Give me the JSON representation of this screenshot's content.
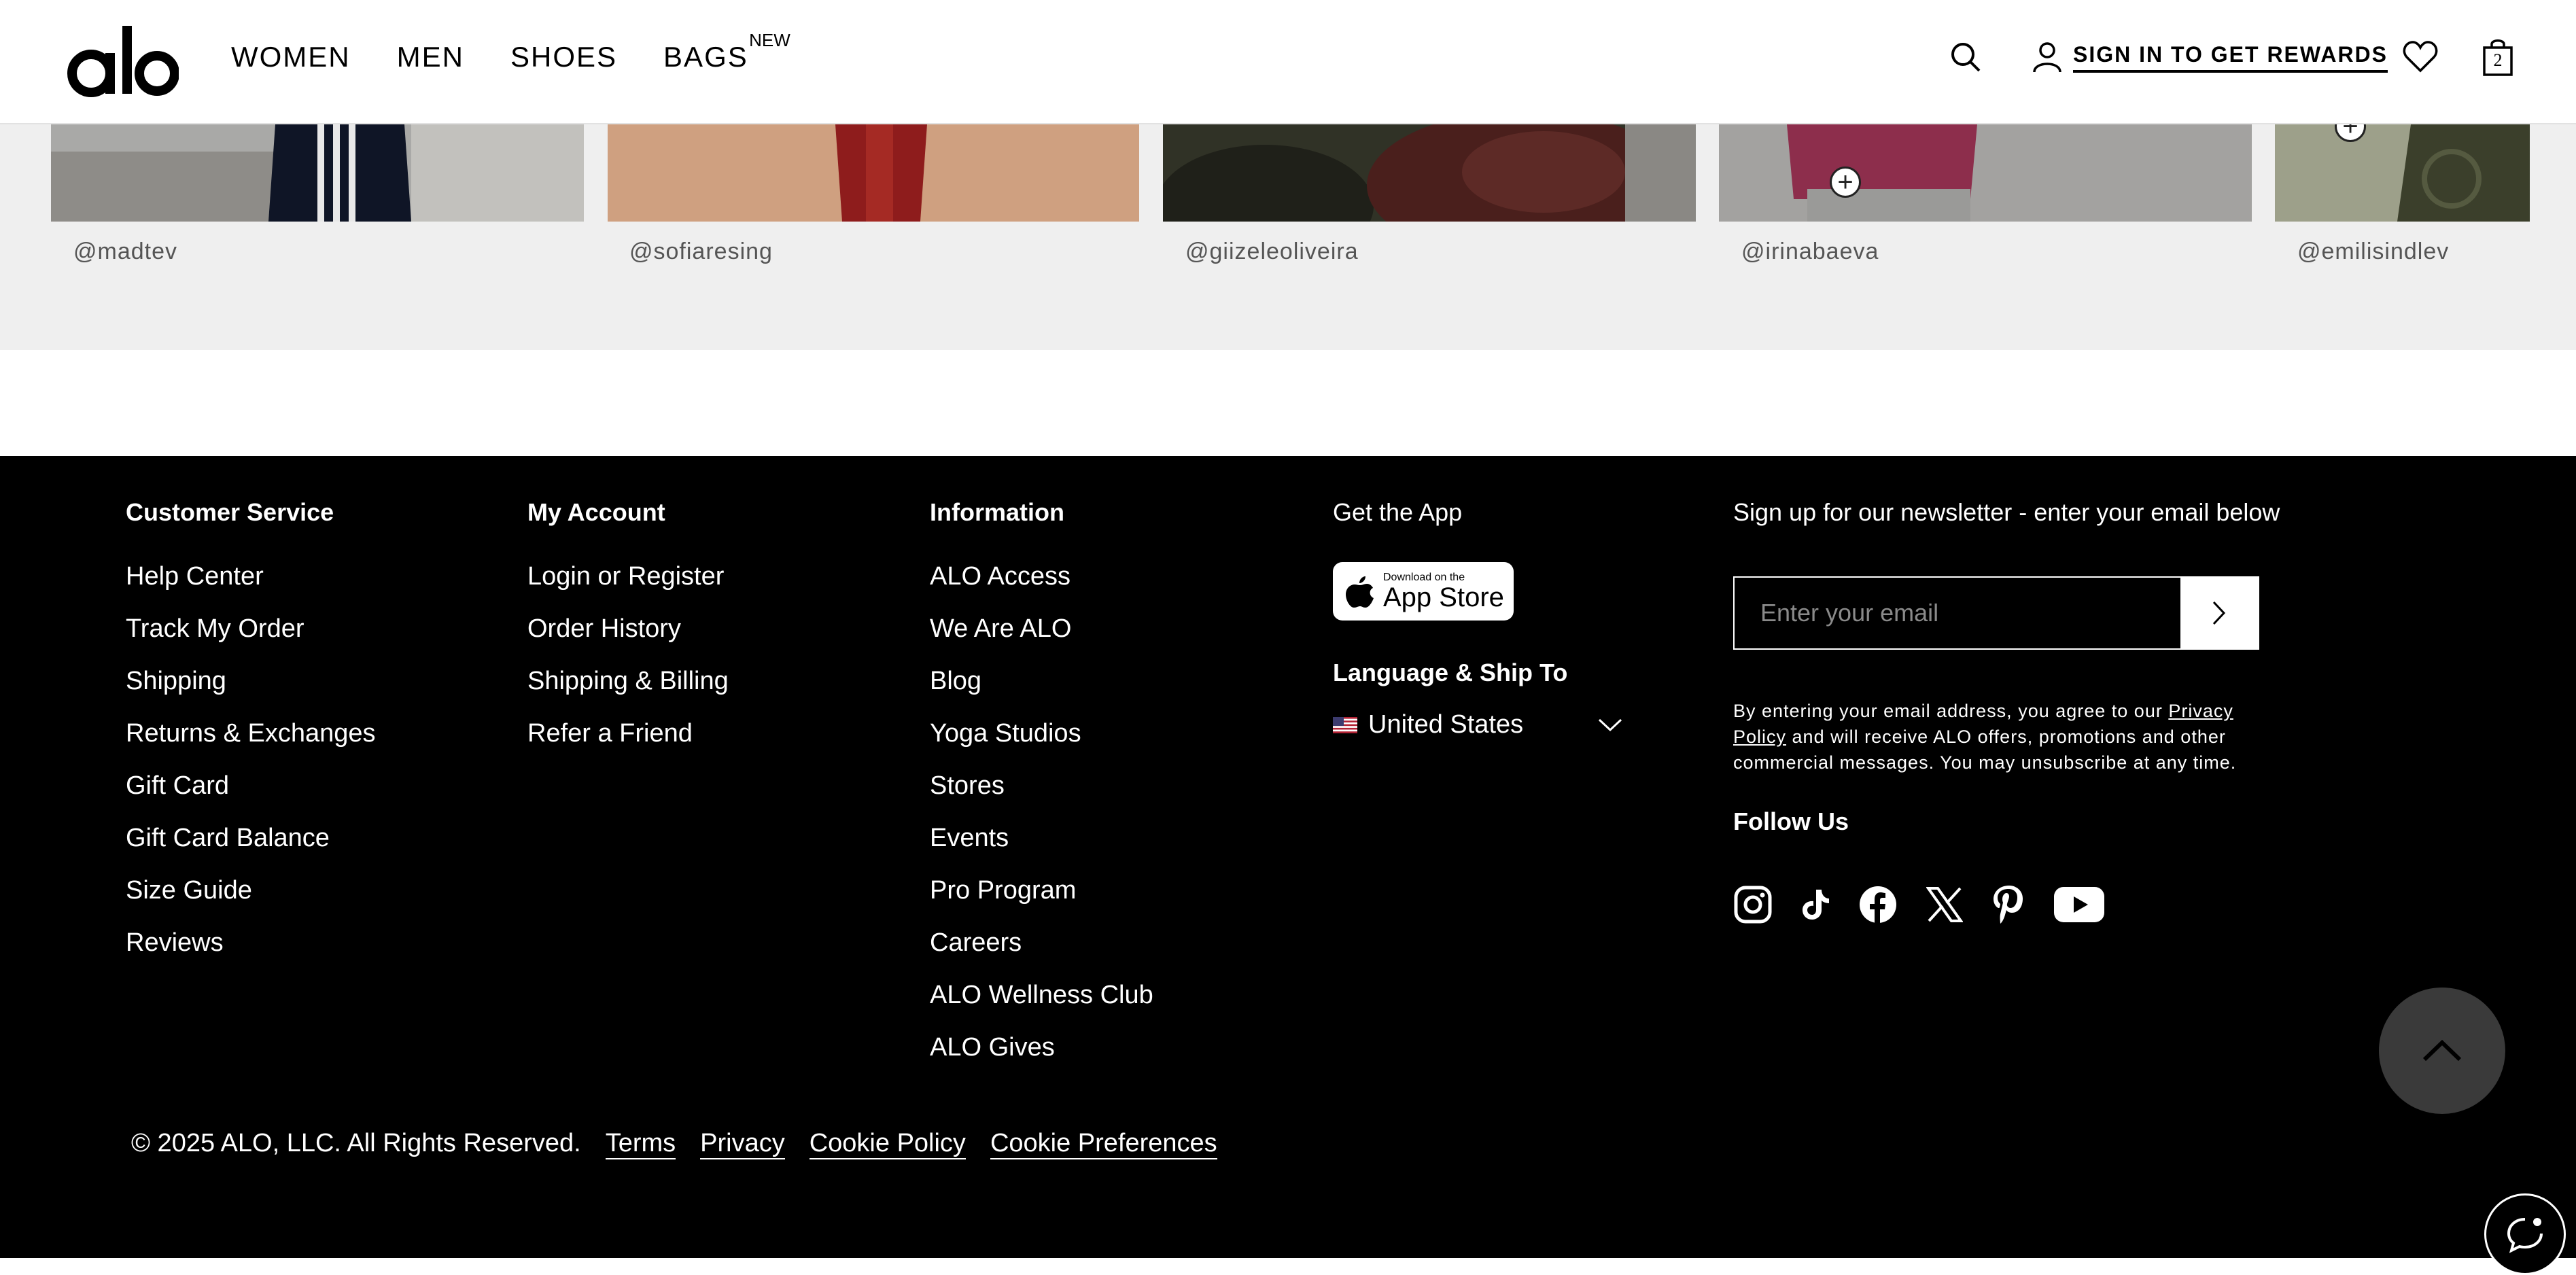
{
  "header": {
    "nav": [
      {
        "label": "WOMEN"
      },
      {
        "label": "MEN"
      },
      {
        "label": "SHOES"
      },
      {
        "label": "BAGS",
        "badge": "NEW"
      }
    ],
    "signin_label": "SIGN IN TO GET REWARDS",
    "cart_count": "2"
  },
  "ugc": {
    "handles": [
      "@madtev",
      "@sofiaresing",
      "@giizeleoliveira",
      "@irinabaeva",
      "@emilisindlev"
    ]
  },
  "footer": {
    "customer_service": {
      "title": "Customer Service",
      "links": [
        "Help Center",
        "Track My Order",
        "Shipping",
        "Returns & Exchanges",
        "Gift Card",
        "Gift Card Balance",
        "Size Guide",
        "Reviews"
      ]
    },
    "my_account": {
      "title": "My Account",
      "links": [
        "Login or Register",
        "Order History",
        "Shipping & Billing",
        "Refer a Friend"
      ]
    },
    "information": {
      "title": "Information",
      "links": [
        "ALO Access",
        "We Are ALO",
        "Blog",
        "Yoga Studios",
        "Stores",
        "Events",
        "Pro Program",
        "Careers",
        "ALO Wellness Club",
        "ALO Gives"
      ]
    },
    "app": {
      "title": "Get the App",
      "badge_small": "Download on the",
      "badge_large": "App Store",
      "lang_title": "Language & Ship To",
      "country": "United States"
    },
    "newsletter": {
      "title": "Sign up for our newsletter - enter your email below",
      "placeholder": "Enter your email",
      "legal_pre": "By entering your email address, you agree to our ",
      "legal_link": "Privacy Policy",
      "legal_post": " and will receive ALO offers, promotions and other commercial messages. You may unsubscribe at any time.",
      "follow_title": "Follow Us",
      "social": [
        "instagram-icon",
        "tiktok-icon",
        "facebook-icon",
        "x-icon",
        "pinterest-icon",
        "youtube-icon"
      ]
    },
    "copyright": "© 2025 ALO, LLC. All Rights Reserved.",
    "bottom_links": [
      "Terms",
      "Privacy",
      "Cookie Policy",
      "Cookie Preferences"
    ]
  }
}
